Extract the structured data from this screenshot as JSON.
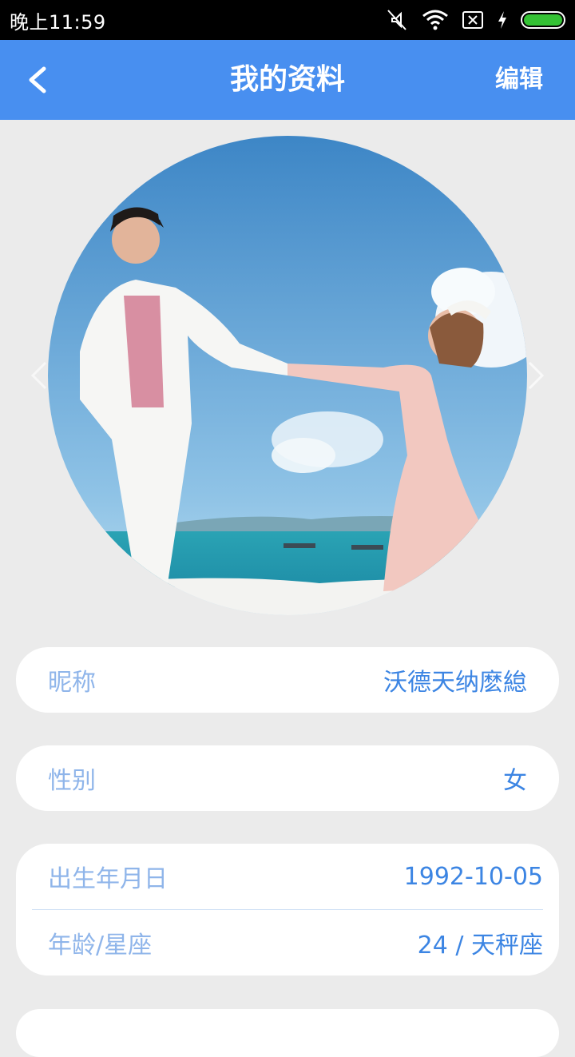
{
  "status_bar": {
    "time": "晚上11:59",
    "icons": [
      "mute-icon",
      "wifi-icon",
      "sim-x-icon",
      "charging-icon",
      "battery-icon"
    ],
    "battery_color": "#34c234"
  },
  "header": {
    "title": "我的资料",
    "edit_label": "编辑",
    "background": "#488ff0"
  },
  "avatar": {
    "description_icon": "profile-photo"
  },
  "profile": {
    "nickname": {
      "label": "昵称",
      "value": "沃德天纳麽緿"
    },
    "gender": {
      "label": "性别",
      "value": "女"
    },
    "birthday": {
      "label": "出生年月日",
      "value": "1992-10-05"
    },
    "age_zodiac": {
      "label": "年龄/星座",
      "value": "24 / 天秤座"
    }
  },
  "colors": {
    "label": "#8fb5ea",
    "value": "#3c85e3",
    "page_bg": "#ebebeb"
  }
}
